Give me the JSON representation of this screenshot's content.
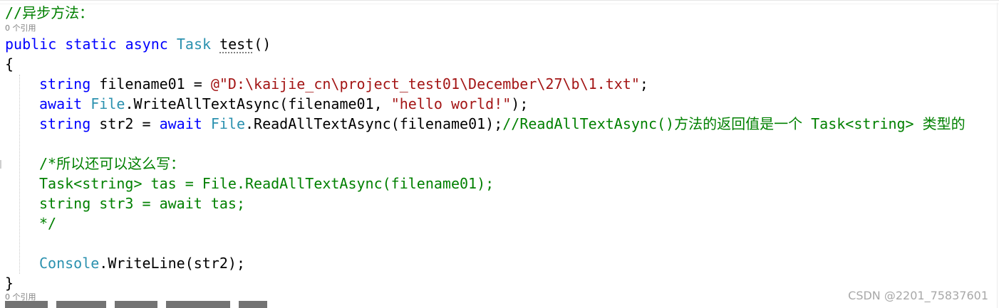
{
  "editor": {
    "colors": {
      "keyword": "#0000ff",
      "type": "#2b91af",
      "string": "#a31515",
      "comment": "#008000",
      "codelens": "#808080"
    },
    "comment_async": "//异步方法：",
    "codelens_refs": "0 个引用",
    "method_sig": {
      "kw1": "public",
      "kw2": "static",
      "kw3": "async",
      "ret_type": "Task",
      "name": "test",
      "parens": "()"
    },
    "open_brace": "{",
    "line_filename": {
      "kw": "string",
      "rest": " filename01 = ",
      "str": "@\"D:\\kaijie_cn\\project_test01\\December\\27\\b\\1.txt\"",
      "end": ";"
    },
    "line_write": {
      "kw": "await",
      "type": "File",
      "call": ".WriteAllTextAsync(filename01, ",
      "str": "\"hello world!\"",
      "end": ");"
    },
    "line_read": {
      "kw": "string",
      "mid": " str2 = ",
      "kw2": "await",
      "type": "File",
      "call": ".ReadAllTextAsync(filename01);",
      "comment": "//ReadAllTextAsync()方法的返回值是一个 Task<string> 类型的"
    },
    "block_comment": [
      "/*所以还可以这么写：",
      "Task<string> tas = File.ReadAllTextAsync(filename01);",
      "string str3 = await tas;",
      "*/"
    ],
    "line_console": {
      "type": "Console",
      "call": ".WriteLine(str2);"
    },
    "close_brace": "}",
    "codelens_refs_2": "0 个引用"
  },
  "watermark": "CSDN @2201_75837601"
}
